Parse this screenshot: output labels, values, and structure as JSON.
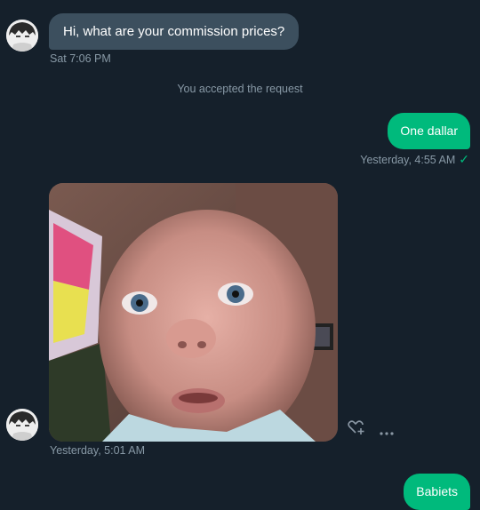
{
  "messages": {
    "incoming_1": {
      "text": "Hi, what are your commission prices?",
      "time": "Sat 7:06 PM"
    },
    "system_1": {
      "text": "You accepted the request"
    },
    "outgoing_1": {
      "text": "One dallar",
      "time": "Yesterday, 4:55 AM",
      "status": "✓"
    },
    "incoming_image": {
      "time": "Yesterday, 5:01 AM"
    },
    "outgoing_2": {
      "text": "Babiets"
    }
  },
  "icons": {
    "react": "heart-plus-icon",
    "more": "more-dots-icon"
  },
  "colors": {
    "background": "#15202b",
    "incoming_bubble": "#3c4f5e",
    "outgoing_bubble": "#00ba7c",
    "meta_text": "#8899a6"
  }
}
